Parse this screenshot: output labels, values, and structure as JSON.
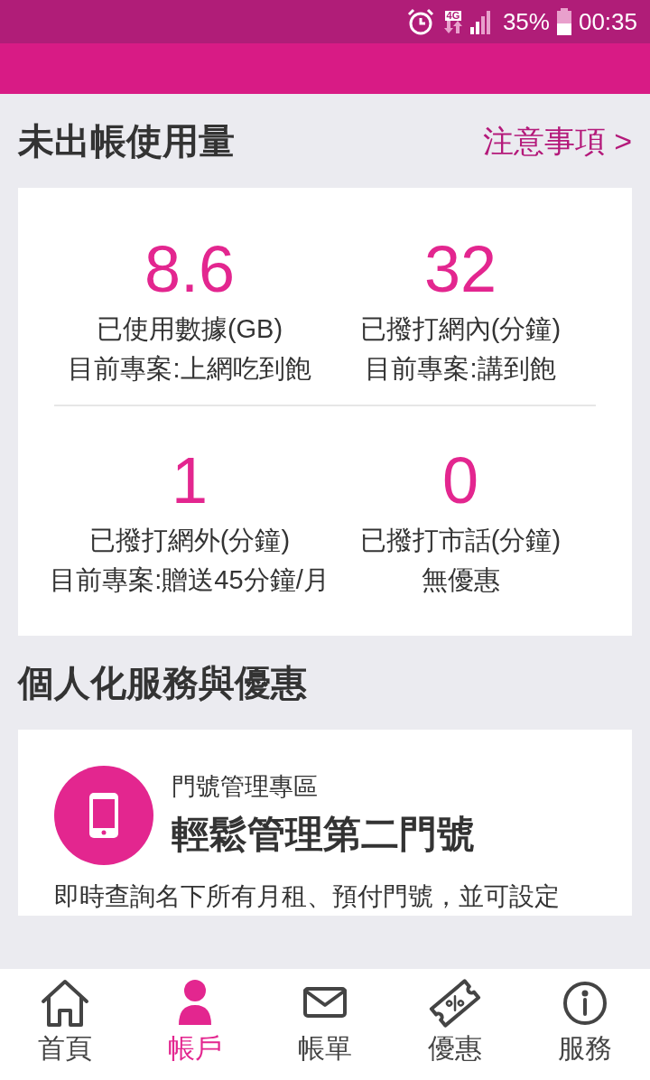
{
  "status_bar": {
    "network": "4G",
    "battery": "35%",
    "time": "00:35"
  },
  "usage": {
    "title": "未出帳使用量",
    "link": "注意事項 >",
    "stats": [
      {
        "value": "8.6",
        "label": "已使用數據(GB)",
        "plan": "目前專案:上網吃到飽"
      },
      {
        "value": "32",
        "label": "已撥打網內(分鐘)",
        "plan": "目前專案:講到飽"
      },
      {
        "value": "1",
        "label": "已撥打網外(分鐘)",
        "plan": "目前專案:贈送45分鐘/月"
      },
      {
        "value": "0",
        "label": "已撥打市話(分鐘)",
        "plan": "無優惠"
      }
    ]
  },
  "services": {
    "title": "個人化服務與優惠",
    "card": {
      "category": "門號管理專區",
      "headline": "輕鬆管理第二門號",
      "description": "即時查詢名下所有月租、預付門號，並可設定"
    }
  },
  "nav": [
    {
      "kind": "home",
      "label": "首頁",
      "selected": false
    },
    {
      "kind": "account",
      "label": "帳戶",
      "selected": true
    },
    {
      "kind": "bill",
      "label": "帳單",
      "selected": false
    },
    {
      "kind": "offer",
      "label": "優惠",
      "selected": false
    },
    {
      "kind": "service",
      "label": "服務",
      "selected": false
    }
  ]
}
